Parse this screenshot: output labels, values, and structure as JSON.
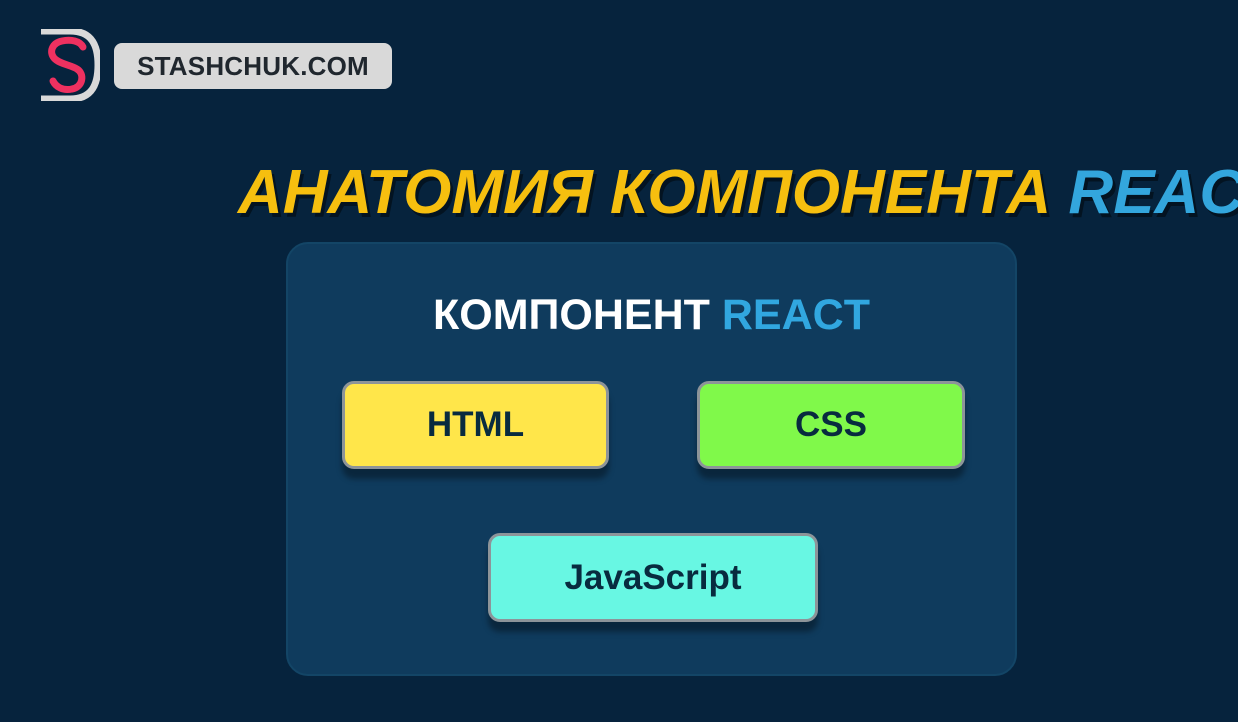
{
  "brand": {
    "logo_icon": "stashchuk-logo-icon",
    "name": "STASHCHUK.COM"
  },
  "headline": {
    "part1": "АНАТОМИЯ КОМПОНЕНТА",
    "part2": "REACT"
  },
  "component_panel": {
    "title_part1": "КОМПОНЕНТ",
    "title_part2": "REACT",
    "items": [
      "HTML",
      "CSS",
      "JavaScript"
    ]
  },
  "colors": {
    "background": "#06233d",
    "panel": "#0f3b5d",
    "headline_yellow": "#f6bf0f",
    "react_blue": "#33a6dd",
    "html_box": "#ffe64a",
    "css_box": "#80f94a",
    "javascript_box": "#68f7e3"
  }
}
